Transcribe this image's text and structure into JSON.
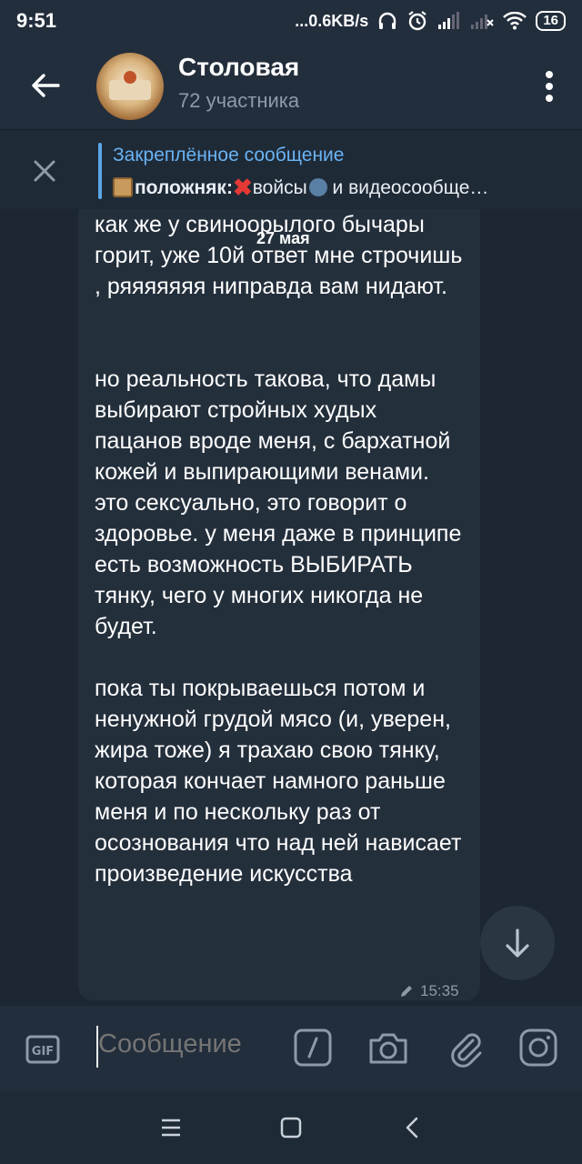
{
  "status_bar": {
    "time": "9:51",
    "net_speed": "...0.6KB/s",
    "battery": "16",
    "icons": [
      "headphones-icon",
      "alarm-icon",
      "signal-icon",
      "signal-icon",
      "wifi-icon",
      "battery-icon"
    ]
  },
  "header": {
    "title": "Столовая",
    "subtitle": "72 участника",
    "back_icon": "arrow-left-icon",
    "menu_icon": "more-vertical-icon"
  },
  "pinned": {
    "title": "Закреплённое сообщение",
    "bold_prefix": "положняк:",
    "text_1": "войсы",
    "text_2": " и видеосообще…",
    "close_icon": "close-icon"
  },
  "chat": {
    "date_label": "27 мая",
    "message_paragraphs": [
      "как же у свиноорылого бычары горит, уже 10й ответ мне строчишь , ряяяяяяя ниправда вам нидают.",
      "",
      "",
      "но реальность такова, что дамы выбирают стройных худых пацанов вроде меня, с бархатной кожей и выпирающими венами.\nэто сексуально, это говорит о здоровье. у меня даже в принципе есть возможность ВЫБИРАТЬ тянку, чего у многих никогда не будет.",
      "",
      "пока ты покрываешься потом и ненужной грудой мясо (и, уверен, жира тоже) я трахаю свою тянку, которая кончает намного раньше меня и по нескольку раз от осознования что над ней нависает произведение искусства"
    ],
    "time": "15:35",
    "edited_icon": "pencil-icon",
    "scroll_down_icon": "arrow-down-icon"
  },
  "input_bar": {
    "placeholder": "Сообщение",
    "icons": [
      "gif-icon",
      "command-slash-icon",
      "camera-icon",
      "attach-icon",
      "instagram-icon"
    ]
  },
  "nav_bar": {
    "icons": [
      "menu-icon",
      "home-square-icon",
      "back-chevron-icon"
    ]
  },
  "colors": {
    "background": "#1d2733",
    "header": "#232e3c",
    "bubble": "#242f3c",
    "accent": "#6ab3f3",
    "secondary_text": "#8d9aa8"
  }
}
